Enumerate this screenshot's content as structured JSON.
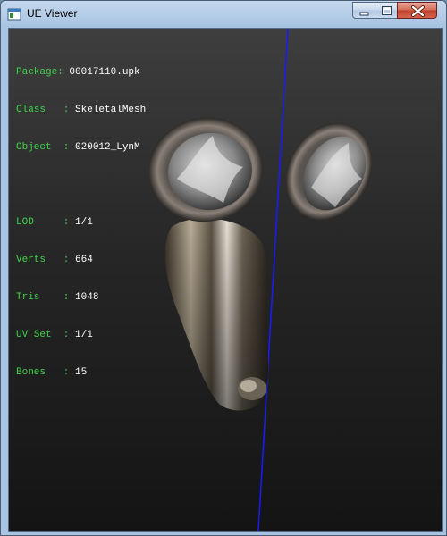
{
  "window": {
    "title": "UE Viewer"
  },
  "info": {
    "package": {
      "key": "Package: ",
      "value": "00017110.upk"
    },
    "class": {
      "key": "Class   : ",
      "value": "SkeletalMesh"
    },
    "object": {
      "key": "Object  : ",
      "value": "020012_LynM"
    },
    "lod": {
      "key": "LOD     : ",
      "value": "1/1"
    },
    "verts": {
      "key": "Verts   : ",
      "value": "664"
    },
    "tris": {
      "key": "Tris    : ",
      "value": "1048"
    },
    "uvset": {
      "key": "UV Set  : ",
      "value": "1/1"
    },
    "bones": {
      "key": "Bones   : ",
      "value": "15"
    }
  },
  "colors": {
    "label": "#41d34a",
    "value": "#ffffff",
    "axis_line": "#1a1aff"
  },
  "icons": {
    "app": "window-app-icon",
    "minimize": "minimize-icon",
    "maximize": "maximize-icon",
    "close": "close-icon"
  }
}
